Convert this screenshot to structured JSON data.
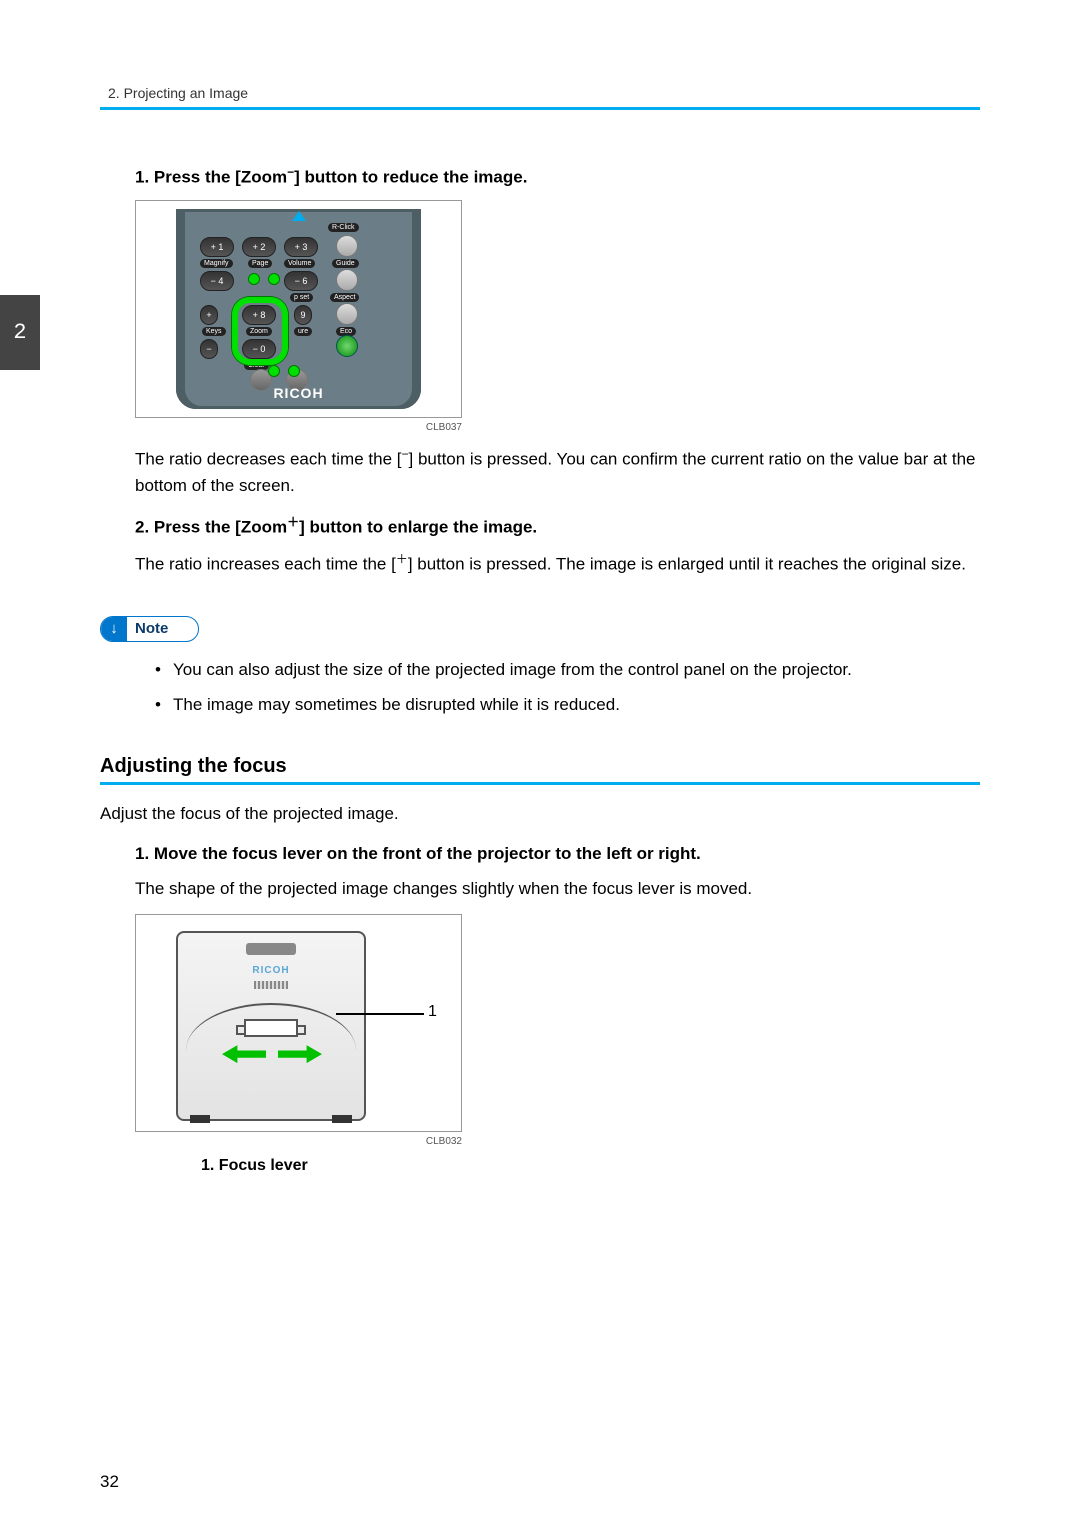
{
  "header": {
    "chapter_ref": "2. Projecting an Image"
  },
  "chapter_tab": "2",
  "step1": {
    "num": "1.",
    "title_a": "Press the [Zoom",
    "title_sym": "−",
    "title_b": "] button to reduce the image.",
    "figure_caption": "CLB037",
    "body_a": "The ratio decreases each time the [",
    "body_sym": "−",
    "body_b": "] button is pressed. You can confirm the current ratio on the value bar at the bottom of the screen."
  },
  "step2": {
    "num": "2.",
    "title_a": "Press the [Zoom",
    "title_sym": "＋",
    "title_b": "] button to enlarge the image.",
    "body_a": "The ratio increases each time the [",
    "body_sym": "＋",
    "body_b": "] button is pressed. The image is enlarged until it reaches the original size."
  },
  "note": {
    "label": "Note",
    "items": [
      "You can also adjust the size of the projected image from the control panel on the projector.",
      "The image may sometimes be disrupted while it is reduced."
    ]
  },
  "section": {
    "title": "Adjusting the focus",
    "intro": "Adjust the focus of the projected image."
  },
  "step3": {
    "num": "1.",
    "title": "Move the focus lever on the front of the projector to the left or right.",
    "body": "The shape of the projected image changes slightly when the focus lever is moved.",
    "figure_caption": "CLB032",
    "callout_num": "1",
    "sub_num": "1.",
    "sub_label": "Focus lever"
  },
  "remote": {
    "logo": "RICOH",
    "labels": {
      "rclick": "R-Click",
      "magnify": "Magnify",
      "page": "Page",
      "volume": "Volume",
      "guide": "Guide",
      "pset": "p set",
      "aspect": "Aspect",
      "keys": "Keys",
      "zoom": "Zoom",
      "ure": "ure",
      "eco": "Eco",
      "clear": "Clear"
    },
    "btns": {
      "p1": "+ 1",
      "p2": "+ 2",
      "p3": "+ 3",
      "m4": "− 4",
      "m6": "− 6",
      "p8": "+ 8",
      "m0": "− 0"
    }
  },
  "projector": {
    "logo": "RICOH"
  },
  "page_number": "32"
}
